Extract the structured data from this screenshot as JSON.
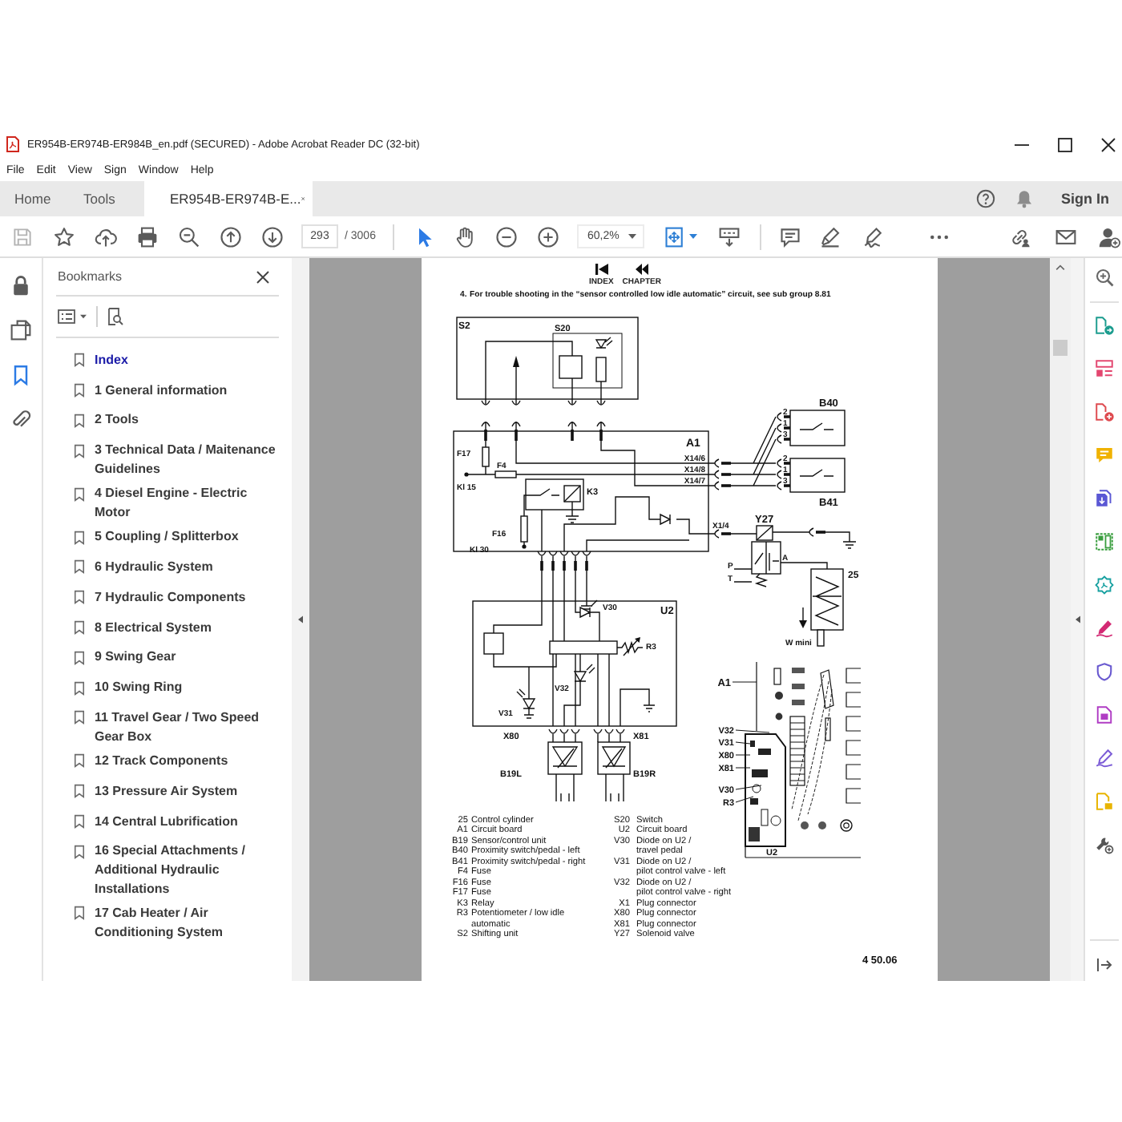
{
  "window": {
    "title": "ER954B-ER974B-ER984B_en.pdf (SECURED) - Adobe Acrobat Reader DC (32-bit)"
  },
  "menu": [
    "File",
    "Edit",
    "View",
    "Sign",
    "Window",
    "Help"
  ],
  "tabs": [
    {
      "kind": "home",
      "label": "Home",
      "selected": false
    },
    {
      "kind": "tools",
      "label": "Tools",
      "selected": false
    },
    {
      "kind": "document",
      "label": "ER954B-ER974B-E...",
      "selected": true
    }
  ],
  "account": {
    "sign_in": "Sign In"
  },
  "toolbar": {
    "page": "293",
    "page_count": "/ 3006",
    "pointer_tools": [
      {
        "kind": "select",
        "selected": true
      },
      {
        "kind": "hand",
        "selected": false
      }
    ],
    "zoom": "60,2%"
  },
  "left_rail": [
    {
      "kind": "lock",
      "selected": false
    },
    {
      "kind": "pages",
      "selected": false
    },
    {
      "kind": "bookmarks",
      "selected": true
    },
    {
      "kind": "attachments",
      "selected": false
    }
  ],
  "bookmarks": {
    "title": "Bookmarks",
    "items": [
      {
        "label": "Index",
        "selected": true
      },
      {
        "label": "1 General information",
        "selected": false
      },
      {
        "label": "2 Tools",
        "selected": false
      },
      {
        "label": "3 Technical Data / Maitenance Guidelines",
        "selected": false
      },
      {
        "label": "4 Diesel Engine - Electric Motor",
        "selected": false
      },
      {
        "label": "5 Coupling / Splitterbox",
        "selected": false
      },
      {
        "label": "6 Hydraulic System",
        "selected": false
      },
      {
        "label": "7 Hydraulic Components",
        "selected": false
      },
      {
        "label": "8 Electrical System",
        "selected": false
      },
      {
        "label": "9 Swing Gear",
        "selected": false
      },
      {
        "label": "10 Swing Ring",
        "selected": false
      },
      {
        "label": "11 Travel Gear / Two Speed Gear Box",
        "selected": false
      },
      {
        "label": "12 Track Components",
        "selected": false
      },
      {
        "label": "13 Pressure Air System",
        "selected": false
      },
      {
        "label": "14 Central Lubrification",
        "selected": false
      },
      {
        "label": "16 Special Attachments / Additional Hydraulic Installations",
        "selected": false
      },
      {
        "label": "17 Cab Heater / Air Conditioning System",
        "selected": false
      }
    ]
  },
  "document": {
    "nav": [
      {
        "kind": "index",
        "label": "INDEX"
      },
      {
        "kind": "chapter",
        "label": "CHAPTER"
      }
    ],
    "step": "4.",
    "instruction": "For trouble shooting in the “sensor controlled low idle automatic” circuit, see sub group 8.81",
    "schematic": {
      "labels": [
        "S2",
        "S20",
        "A1",
        "F17",
        "F4",
        "Kl 15",
        "K3",
        "F16",
        "Kl 30",
        "X14/6",
        "X14/8",
        "X14/7",
        "X1/4",
        "B40",
        "2",
        "1",
        "3",
        "2",
        "1",
        "3",
        "B41",
        "Y27",
        "P",
        "T",
        "A",
        "25",
        "W mini",
        "U2",
        "V30",
        "R3",
        "V32",
        "V31",
        "X80",
        "X81",
        "B19L",
        "B19R"
      ]
    },
    "board_view": {
      "labels": [
        "A1",
        "V32",
        "V31",
        "X80",
        "X81",
        "V30",
        "R3",
        "U2"
      ]
    },
    "legend_columns": [
      [
        {
          "code": "25",
          "text": "Control cylinder"
        },
        {
          "code": "A1",
          "text": "Circuit board"
        },
        {
          "code": "B19",
          "text": "Sensor/control unit"
        },
        {
          "code": "B40",
          "text": "Proximity switch/pedal - left"
        },
        {
          "code": "B41",
          "text": "Proximity switch/pedal - right"
        },
        {
          "code": "F4",
          "text": "Fuse"
        },
        {
          "code": "F16",
          "text": "Fuse"
        },
        {
          "code": "F17",
          "text": "Fuse"
        },
        {
          "code": "K3",
          "text": "Relay"
        },
        {
          "code": "R3",
          "text": "Potentiometer / low idle\nautomatic"
        },
        {
          "code": "S2",
          "text": "Shifting unit"
        }
      ],
      [
        {
          "code": "S20",
          "text": "Switch"
        },
        {
          "code": "U2",
          "text": "Circuit board"
        },
        {
          "code": "V30",
          "text": "Diode on U2 /\ntravel pedal"
        },
        {
          "code": "V31",
          "text": "Diode on U2 /\npilot control valve - left"
        },
        {
          "code": "V32",
          "text": "Diode on U2 /\npilot control valve - right"
        },
        {
          "code": "X1",
          "text": "Plug connector"
        },
        {
          "code": "X80",
          "text": "Plug connector"
        },
        {
          "code": "X81",
          "text": "Plug connector"
        },
        {
          "code": "Y27",
          "text": "Solenoid valve"
        }
      ]
    ],
    "page_number": "4 50.06"
  }
}
